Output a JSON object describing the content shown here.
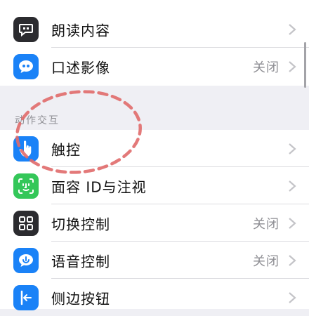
{
  "top_group": {
    "items": [
      {
        "label": "朗读内容",
        "value": "",
        "icon": "speech-bubble-icon",
        "color": "#2b2b2f"
      },
      {
        "label": "口述影像",
        "value": "关闭",
        "icon": "quote-bubble-icon",
        "color": "#1a82f7"
      }
    ]
  },
  "section": {
    "header": "动作交互",
    "items": [
      {
        "label": "触控",
        "value": "",
        "icon": "hand-touch-icon",
        "color": "#1a82f7"
      },
      {
        "label": "面容 ID与注视",
        "value": "",
        "icon": "face-id-icon",
        "color": "#34c759"
      },
      {
        "label": "切换控制",
        "value": "关闭",
        "icon": "switch-grid-icon",
        "color": "#2b2b2f"
      },
      {
        "label": "语音控制",
        "value": "关闭",
        "icon": "voice-bubble-icon",
        "color": "#1a82f7"
      },
      {
        "label": "侧边按钮",
        "value": "",
        "icon": "side-button-icon",
        "color": "#1a82f7"
      }
    ]
  },
  "annotation": {
    "shape": "dashed-ellipse",
    "color": "#e06a6a",
    "target": "触控"
  }
}
